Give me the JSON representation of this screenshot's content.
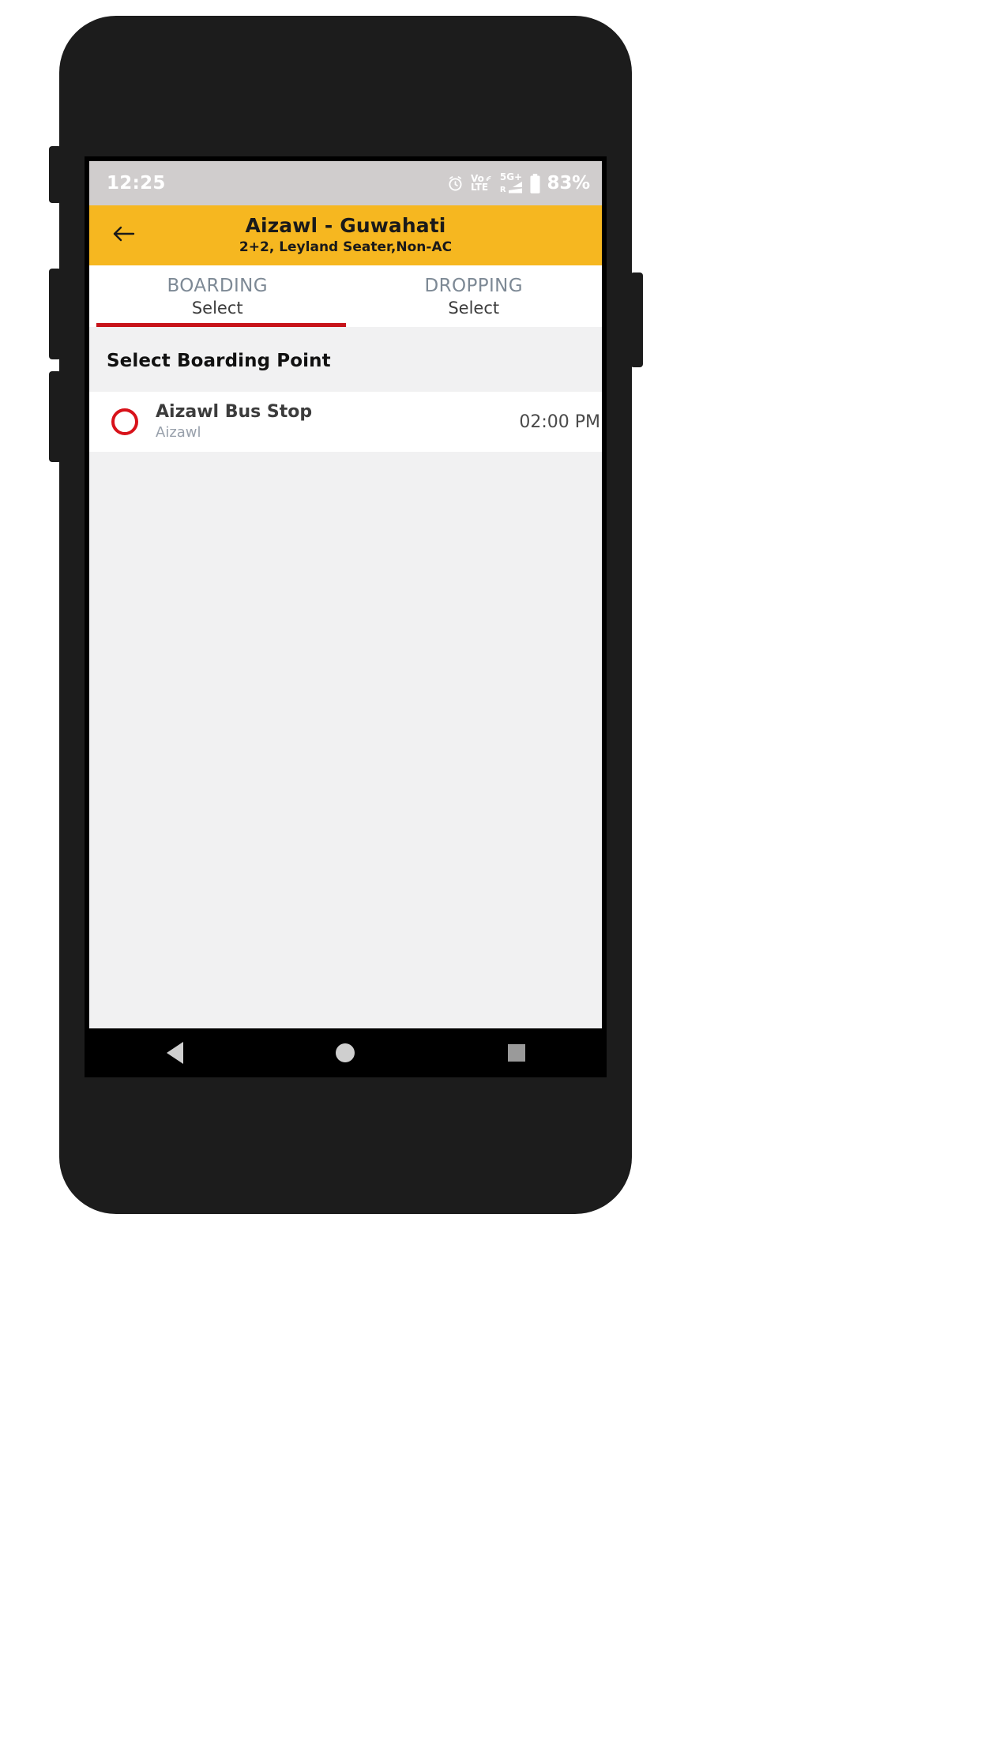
{
  "status_bar": {
    "time": "12:25",
    "alarm_icon": "alarm-clock-icon",
    "volte_top": "Vo",
    "volte_bottom": "LTE",
    "network_label": "5G+",
    "roaming_label": "R",
    "battery_percent": "83%"
  },
  "app_bar": {
    "back_icon": "back-arrow-icon",
    "title": "Aizawl - Guwahati",
    "subtitle": "2+2, Leyland Seater,Non-AC",
    "background_color": "#f6b720"
  },
  "tabs": {
    "active_index": 0,
    "indicator_color": "#c7131a",
    "items": [
      {
        "heading": "BOARDING",
        "value": "Select"
      },
      {
        "heading": "DROPPING",
        "value": "Select"
      }
    ]
  },
  "main": {
    "section_title": "Select Boarding Point",
    "points": [
      {
        "name": "Aizawl Bus Stop",
        "city": "Aizawl",
        "time": "02:00 PM",
        "selected": false,
        "radio_color": "#d8121a"
      }
    ]
  },
  "nav_bar": {
    "back_icon": "nav-back-triangle-icon",
    "home_icon": "nav-home-circle-icon",
    "recents_icon": "nav-recents-square-icon"
  }
}
